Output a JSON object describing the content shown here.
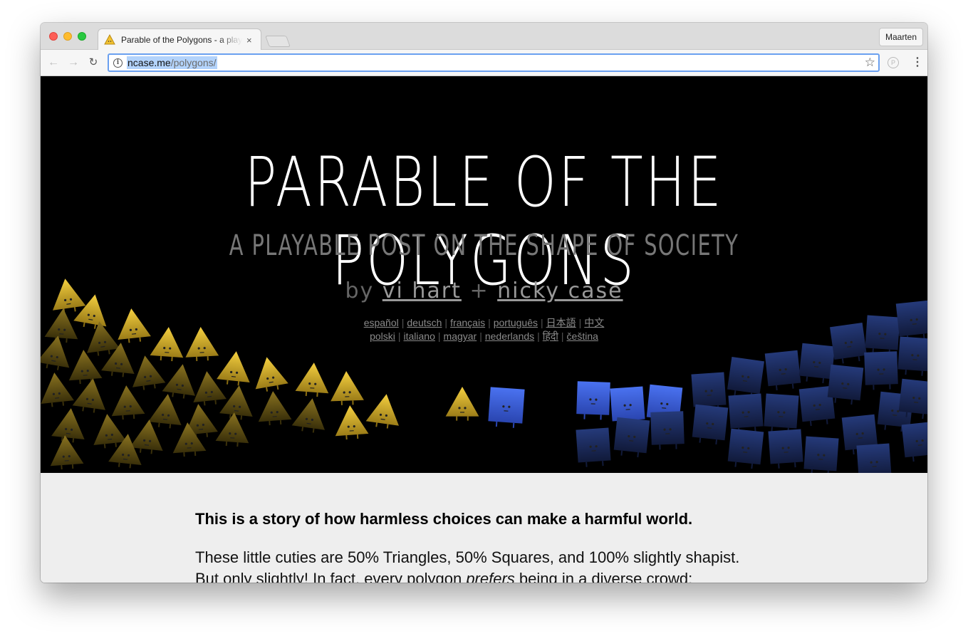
{
  "browser": {
    "tab_title": "Parable of the Polygons - a playable post on the shape of society",
    "tab_close": "×",
    "profile_name": "Maarten",
    "url_domain": "ncase.me",
    "url_path": "/polygons/",
    "icons": [
      "back-arrow-icon",
      "forward-arrow-icon",
      "reload-icon",
      "info-icon",
      "star-icon",
      "extension-icon",
      "menu-icon"
    ]
  },
  "hero": {
    "title": "PARABLE OF THE POLYGONS",
    "subtitle": "A PLAYABLE POST ON THE SHAPE OF SOCIETY",
    "by": "by",
    "plus": "+",
    "author1": "vi hart",
    "author2": "nicky case",
    "languages_row1": [
      "español",
      "deutsch",
      "français",
      "português",
      "日本語",
      "中文"
    ],
    "languages_row2": [
      "polski",
      "italiano",
      "magyar",
      "nederlands",
      "हिंदी",
      "čeština"
    ],
    "colors": {
      "triangle": "#f5cf3a",
      "square": "#3a63e8",
      "background": "#000000"
    }
  },
  "article": {
    "lead": "This is a story of how harmless choices can make a harmful world.",
    "para1": "These little cuties are 50% Triangles, 50% Squares, and 100% slightly shapist.",
    "para2_a": "But only slightly! In fact, every polygon ",
    "para2_em": "prefers",
    "para2_b": " being in a diverse crowd:"
  }
}
